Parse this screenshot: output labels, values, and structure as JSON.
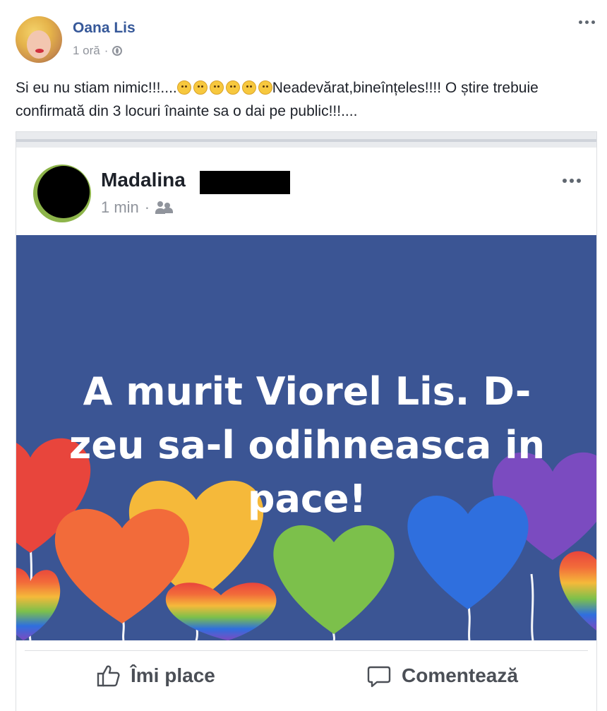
{
  "post": {
    "author": "Oana Lis",
    "time": "1 oră",
    "separator": "·",
    "text_before_emoji": "Si eu nu stiam nimic!!!....",
    "emoji_icons": [
      "grinning-icon",
      "laughing-icon",
      "tongue-wink-icon",
      "smiling-icon",
      "relieved-icon",
      "relieved-icon"
    ],
    "text_after_emoji": "Neadevărat,bineînțeles!!!! O știre trebuie confirmată din 3 locuri înainte sa o dai pe public!!!...."
  },
  "shared": {
    "author_first_name": "Madalina",
    "time": "1 min",
    "separator": "·",
    "audience_icon": "friends-icon",
    "image_text": "A murit Viorel Lis. D-zeu sa-l odihneasca in pace!",
    "background_color": "#3b5594",
    "heart_colors": [
      "#e8453c",
      "#f26b3a",
      "#f5b93a",
      "#7cc04b",
      "#2f6fde",
      "#7b4bc0"
    ]
  },
  "actions": {
    "like_label": "Îmi place",
    "comment_label": "Comentează"
  }
}
